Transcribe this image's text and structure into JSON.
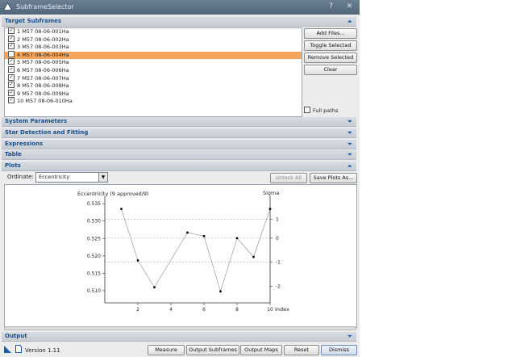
{
  "window": {
    "title": "SubframeSelector"
  },
  "sections": {
    "target": "Target Subframes",
    "system": "System Parameters",
    "star": "Star Detection and Fitting",
    "expressions": "Expressions",
    "table": "Table",
    "plots": "Plots",
    "output": "Output"
  },
  "subframes": [
    {
      "label": "1 M57 08-06-001Ha",
      "checked": true
    },
    {
      "label": "2 M57 08-06-002Ha",
      "checked": true
    },
    {
      "label": "3 M57 08-06-003Ha",
      "checked": true
    },
    {
      "label": "4 M57 08-06-004Ha",
      "checked": false,
      "selected": true
    },
    {
      "label": "5 M57 08-06-005Ha",
      "checked": true
    },
    {
      "label": "6 M57 08-06-006Ha",
      "checked": true
    },
    {
      "label": "7 M57 08-06-007Ha",
      "checked": true
    },
    {
      "label": "8 M57 08-06-008Ha",
      "checked": true
    },
    {
      "label": "9 M57 08-06-009Ha",
      "checked": true
    },
    {
      "label": "10 M57 08-06-010Ha",
      "checked": true
    }
  ],
  "side_buttons": {
    "add": "Add Files...",
    "toggle": "Toggle Selected",
    "remove": "Remove Selected",
    "clear": "Clear"
  },
  "full_paths": {
    "label": "Full paths",
    "checked": false
  },
  "plots": {
    "ordinate_label": "Ordinate:",
    "ordinate_value": "Eccentricity",
    "unlock_label": "Unlock All",
    "save_label": "Save Plots As..."
  },
  "bottom": {
    "version": "Version 1.11",
    "measure": "Measure",
    "output_subframes": "Output Subframes",
    "output_maps": "Output Maps",
    "reset": "Reset",
    "dismiss": "Dismiss"
  },
  "colors": {
    "section_text": "#1a4f86",
    "selected_row": "#f4a55a",
    "accent": "#1a5aa6"
  },
  "chart_data": {
    "type": "scatter",
    "title": "Eccentricity (9 approved/9)",
    "right_axis_label": "Sigma",
    "xlabel": "Index",
    "x": [
      1,
      2,
      3,
      4,
      5,
      6,
      7,
      8,
      9,
      10
    ],
    "y": [
      0.5335,
      0.5187,
      0.511,
      null,
      0.5267,
      0.5257,
      0.5098,
      0.5251,
      0.5197,
      0.5335
    ],
    "xlim": [
      0,
      10
    ],
    "ylim": [
      0.5065,
      0.5362
    ],
    "x_ticks": [
      2,
      4,
      6,
      8,
      10
    ],
    "y_ticks": [
      0.51,
      0.515,
      0.52,
      0.525,
      0.53,
      0.535
    ],
    "y_tick_labels": [
      "0.510",
      "0.515",
      "0.520",
      "0.525",
      "0.530",
      "0.535"
    ],
    "sigma_ticks": [
      "1",
      "0",
      "-1",
      "-2"
    ],
    "sigma_values": [
      1,
      0,
      -1,
      -2
    ],
    "sigma_ref_lines": [
      1,
      0,
      -1
    ]
  }
}
